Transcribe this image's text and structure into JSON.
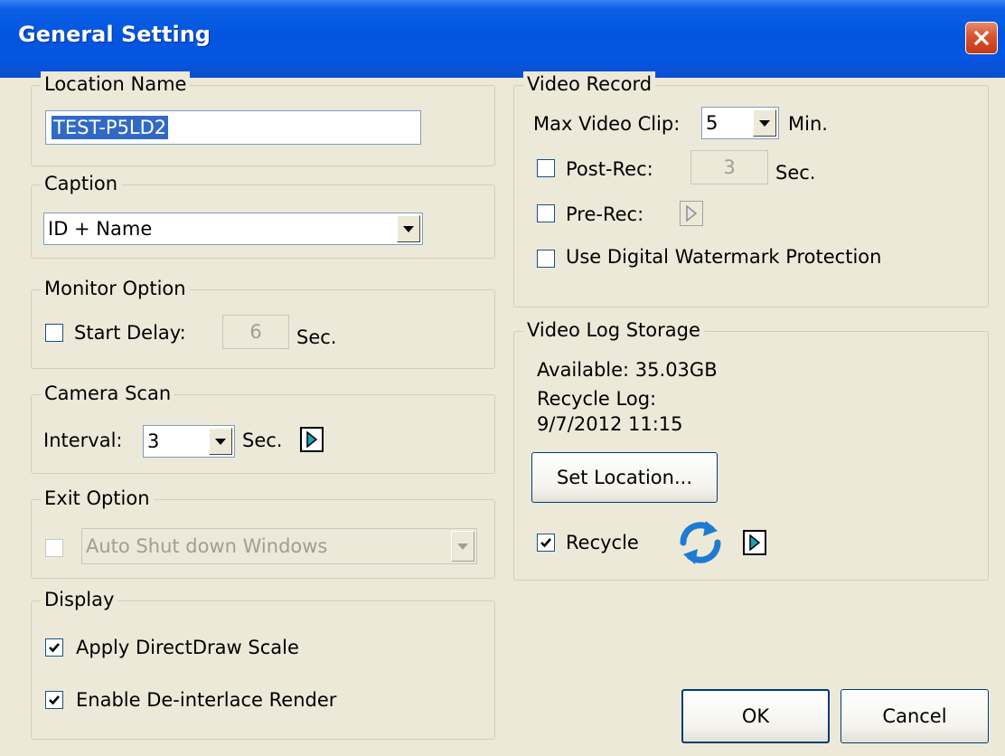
{
  "window": {
    "title": "General Setting"
  },
  "location": {
    "legend": "Location Name",
    "value": "TEST-P5LD2"
  },
  "caption": {
    "legend": "Caption",
    "value": "ID + Name"
  },
  "monitor": {
    "legend": "Monitor Option",
    "start_delay_label": "Start Delay:",
    "start_delay_value": "6",
    "unit": "Sec.",
    "checked": false
  },
  "camera_scan": {
    "legend": "Camera Scan",
    "interval_label": "Interval:",
    "interval_value": "3",
    "unit": "Sec."
  },
  "exit": {
    "legend": "Exit Option",
    "value": "Auto Shut down Windows",
    "checked": false
  },
  "display": {
    "legend": "Display",
    "directdraw_label": "Apply DirectDraw Scale",
    "directdraw_checked": true,
    "deinterlace_label": "Enable De-interlace Render",
    "deinterlace_checked": true
  },
  "video_record": {
    "legend": "Video Record",
    "max_clip_label": "Max Video Clip:",
    "max_clip_value": "5",
    "max_clip_unit": "Min.",
    "post_rec_label": "Post-Rec:",
    "post_rec_value": "3",
    "post_rec_unit": "Sec.",
    "pre_rec_label": "Pre-Rec:",
    "watermark_label": "Use Digital Watermark Protection"
  },
  "storage": {
    "legend": "Video Log Storage",
    "available": "Available: 35.03GB",
    "recycle_log_label": "Recycle Log:",
    "recycle_log_date": "9/7/2012 11:15",
    "set_location": "Set Location...",
    "recycle_label": "Recycle",
    "recycle_checked": true
  },
  "buttons": {
    "ok": "OK",
    "cancel": "Cancel"
  },
  "colors": {
    "titlebar": "#0355DF",
    "background": "#ECE9D8",
    "selection": "#316AC5",
    "recycle_icon": "#1E7BD3"
  }
}
